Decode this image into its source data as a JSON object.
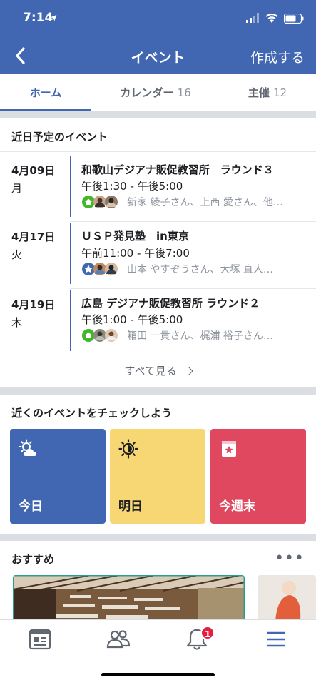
{
  "status_bar": {
    "time": "7:14",
    "location_arrow": "➤"
  },
  "nav": {
    "back_icon": "chevron-left-icon",
    "title": "イベント",
    "create": "作成する"
  },
  "tabs": [
    {
      "label": "ホーム",
      "count": ""
    },
    {
      "label": "カレンダー",
      "count": "16"
    },
    {
      "label": "主催",
      "count": "12"
    }
  ],
  "upcoming": {
    "title": "近日予定のイベント",
    "events": [
      {
        "date": "4月09日",
        "dow": "月",
        "title": "和歌山デジアナ販促教習所　ラウンド３",
        "time": "午後1:30 - 午後5:00",
        "guests": "新家 綾子さん、上西 愛さん、他…",
        "status_icon": "home-icon"
      },
      {
        "date": "4月17日",
        "dow": "火",
        "title": "ＵＳＰ発見塾　in東京",
        "time": "午前11:00 - 午後7:00",
        "guests": "山本 やすぞうさん、大塚 直人…",
        "status_icon": "star-icon"
      },
      {
        "date": "4月19日",
        "dow": "木",
        "title": "広島 デジアナ販促教習所 ラウンド２",
        "time": "午後1:00 - 午後5:00",
        "guests": "箱田 一貴さん、梶浦 裕子さん…",
        "status_icon": "home-icon"
      }
    ],
    "see_all": "すべて見る"
  },
  "nearby": {
    "title": "近くのイベントをチェックしよう",
    "cards": [
      {
        "label": "今日",
        "icon": "sun-cloud-icon",
        "color": "#4267b2"
      },
      {
        "label": "明日",
        "icon": "sun-icon",
        "color": "#f7d774"
      },
      {
        "label": "今週末",
        "icon": "calendar-star-icon",
        "color": "#e0485f"
      }
    ]
  },
  "recommended": {
    "title": "おすすめ",
    "more": "•••"
  },
  "tabbar": {
    "items": [
      "news-feed-icon",
      "friends-icon",
      "notifications-icon",
      "menu-icon"
    ],
    "badge": "1"
  },
  "colors": {
    "brand": "#4267b2",
    "separator": "#dadde1",
    "badge": "#e41e3f"
  }
}
